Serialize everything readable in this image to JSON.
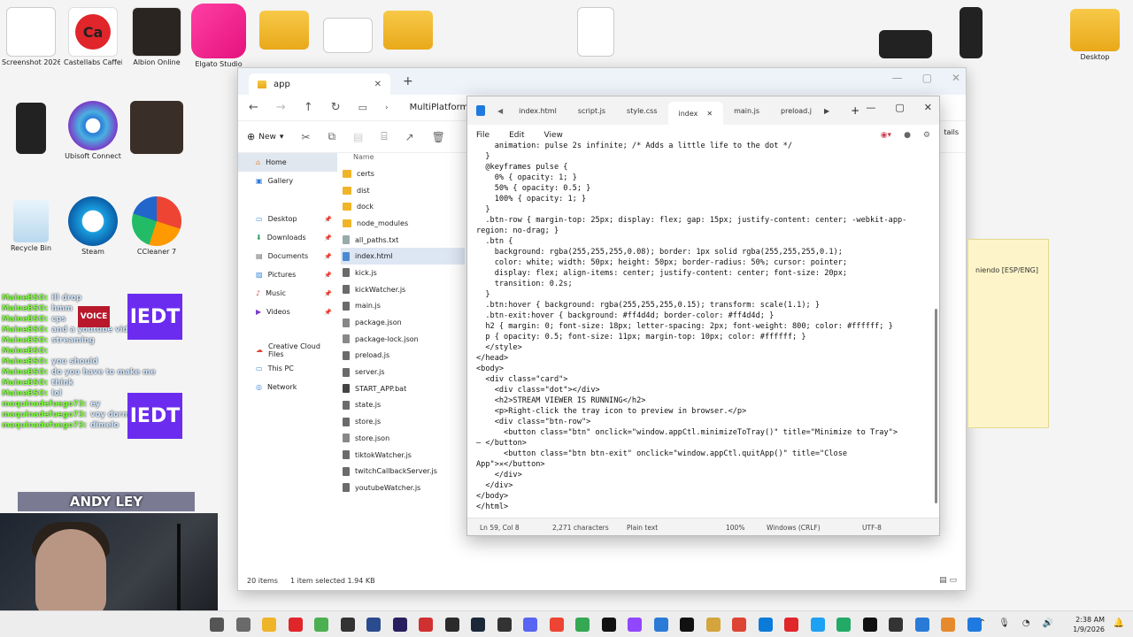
{
  "desktop": {
    "icons": [
      {
        "label": "Screenshot 2026-01-...",
        "icon": "screenshot-thumb"
      },
      {
        "label": "Castellabs Caffeinated",
        "icon": "app-icon"
      },
      {
        "label": "Albion Online",
        "icon": "app-icon"
      },
      {
        "label": "Elgato Studio",
        "icon": "app-icon"
      },
      {
        "label": "Desktop",
        "icon": "folder-icon"
      },
      {
        "label": "Ubisoft Connect",
        "icon": "app-icon"
      },
      {
        "label": "Recycle Bin",
        "icon": "recycle-bin-icon"
      },
      {
        "label": "Steam",
        "icon": "app-icon"
      },
      {
        "label": "CCleaner 7",
        "icon": "app-icon"
      }
    ]
  },
  "explorer": {
    "tab_title": "app",
    "address": "MultiPlatformLiveC",
    "toolbar": {
      "new_label": "New"
    },
    "details_label": "tails",
    "nav": [
      {
        "label": "Home",
        "selected": true
      },
      {
        "label": "Gallery"
      },
      {
        "label": "Desktop",
        "pinned": true
      },
      {
        "label": "Downloads",
        "pinned": true
      },
      {
        "label": "Documents",
        "pinned": true
      },
      {
        "label": "Pictures",
        "pinned": true
      },
      {
        "label": "Music",
        "pinned": true
      },
      {
        "label": "Videos",
        "pinned": true
      },
      {
        "label": "Creative Cloud Files"
      },
      {
        "label": "This PC"
      },
      {
        "label": "Network"
      }
    ],
    "column_header": "Name",
    "files": [
      "certs",
      "dist",
      "dock",
      "node_modules",
      "all_paths.txt",
      "index.html",
      "kick.js",
      "kickWatcher.js",
      "main.js",
      "package.json",
      "package-lock.json",
      "preload.js",
      "server.js",
      "START_APP.bat",
      "state.js",
      "store.js",
      "store.json",
      "tiktokWatcher.js",
      "twitchCallbackServer.js",
      "youtubeWatcher.js"
    ],
    "file_types": [
      "folder",
      "folder",
      "folder",
      "folder",
      "txt",
      "html",
      "js",
      "js",
      "js",
      "json",
      "json",
      "js",
      "js",
      "bat",
      "js",
      "js",
      "json",
      "js",
      "js",
      "js"
    ],
    "selected_file": "index.html",
    "status": {
      "count": "20 items",
      "selected": "1 item selected  1.94 KB"
    }
  },
  "notepad": {
    "tabs": [
      "index.html",
      "script.js",
      "style.css",
      "index",
      "main.js",
      "preload.j"
    ],
    "active_tab": "index",
    "menu": [
      "File",
      "Edit",
      "View"
    ],
    "code_lines": [
      "    animation: pulse 2s infinite; /* Adds a little life to the dot */",
      "  }",
      "  @keyframes pulse {",
      "    0% { opacity: 1; }",
      "    50% { opacity: 0.5; }",
      "    100% { opacity: 1; }",
      "  }",
      "  .btn-row { margin-top: 25px; display: flex; gap: 15px; justify-content: center; -webkit-app-",
      "region: no-drag; }",
      "  .btn {",
      "    background: rgba(255,255,255,0.08); border: 1px solid rgba(255,255,255,0.1);",
      "    color: white; width: 50px; height: 50px; border-radius: 50%; cursor: pointer;",
      "    display: flex; align-items: center; justify-content: center; font-size: 20px;",
      "    transition: 0.2s;",
      "  }",
      "  .btn:hover { background: rgba(255,255,255,0.15); transform: scale(1.1); }",
      "  .btn-exit:hover { background: #ff4d4d; border-color: #ff4d4d; }",
      "  h2 { margin: 0; font-size: 18px; letter-spacing: 2px; font-weight: 800; color: #ffffff; }",
      "  p { opacity: 0.5; font-size: 11px; margin-top: 10px; color: #ffffff; }",
      "  </style>",
      "</head>",
      "<body>",
      "  <div class=\"card\">",
      "    <div class=\"dot\"></div>",
      "    <h2>STREAM VIEWER IS RUNNING</h2>",
      "    <p>Right-click the tray icon to preview in browser.</p>",
      "    <div class=\"btn-row\">",
      "      <button class=\"btn\" onclick=\"window.appCtl.minimizeToTray()\" title=\"Minimize to Tray\">",
      "— </button>",
      "      <button class=\"btn btn-exit\" onclick=\"window.appCtl.quitApp()\" title=\"Close",
      "App\">✕</button>",
      "    </div>",
      "  </div>",
      "</body>",
      "</html>"
    ],
    "status": {
      "position": "Ln 59, Col 8",
      "chars": "2,271 characters",
      "format": "Plain text",
      "zoom": "100%",
      "eol": "Windows (CRLF)",
      "encoding": "UTF-8"
    }
  },
  "stream_overlay": {
    "chat": [
      {
        "user": "MaineBSO:",
        "msg": "ill drop"
      },
      {
        "user": "MaineBSO:",
        "msg": "hmm"
      },
      {
        "user": "MaineBSO:",
        "msg": "cps"
      },
      {
        "user": "MaineBSO:",
        "msg": "and a youtube video"
      },
      {
        "user": "MaineBSO:",
        "msg": "streaming"
      },
      {
        "user": "MaineBSO:",
        "msg": ""
      },
      {
        "user": "MaineBSO:",
        "msg": "you should"
      },
      {
        "user": "MaineBSO:",
        "msg": "do you have to make me"
      },
      {
        "user": "MaineBSO:",
        "msg": "think"
      },
      {
        "user": "MaineBSO:",
        "msg": "lol"
      },
      {
        "user": "maquinadefuego73:",
        "msg": "ey"
      },
      {
        "user": "maquinadefuego73:",
        "msg": "voy dormi"
      },
      {
        "user": "maquinadefuego73:",
        "msg": "dímelo"
      }
    ],
    "badges": [
      "IEDT",
      "IEDT",
      "VOICE",
      "ANDY LEY"
    ]
  },
  "side_window": {
    "text": "niendo [ESP/ENG]"
  },
  "taskbar": {
    "time": "2:38 AM",
    "date": "1/9/2026"
  }
}
